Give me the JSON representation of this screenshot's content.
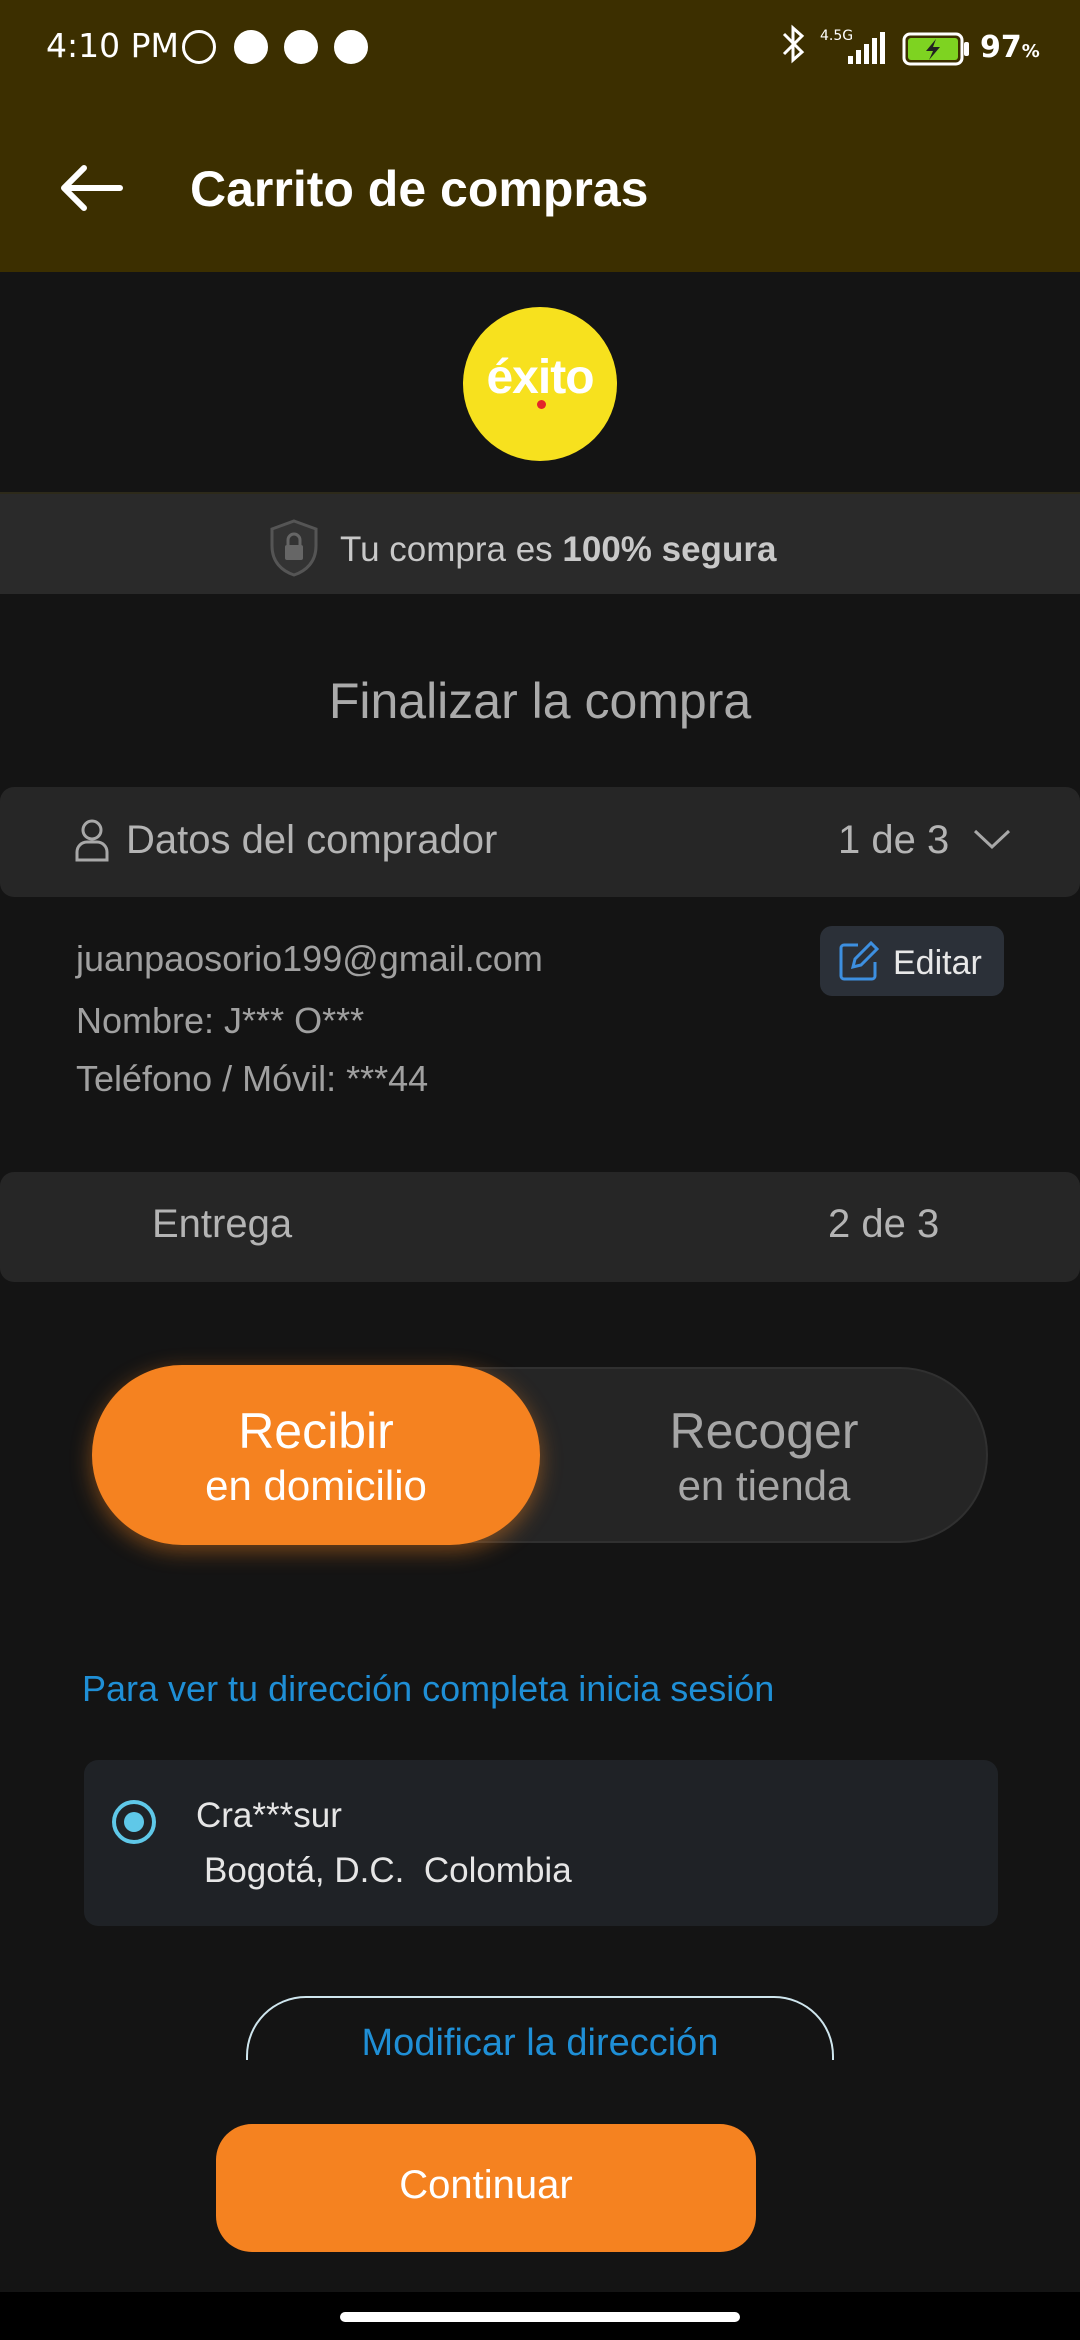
{
  "status_bar": {
    "time": "4:10 PM",
    "network": "4.5G",
    "battery": "97",
    "battery_unit": "%",
    "icons": [
      "alarm-icon",
      "app-icon",
      "app-icon",
      "app-icon",
      "bluetooth-icon",
      "signal-icon",
      "battery-charging-icon"
    ]
  },
  "header": {
    "title": "Carrito de compras",
    "back_icon": "arrow-left-icon"
  },
  "brand": {
    "logo_text": "éxito",
    "logo_color": "#f7e11e"
  },
  "security": {
    "prefix": "Tu compra es ",
    "bold": "100% segura"
  },
  "checkout": {
    "heading": "Finalizar la compra",
    "buyer_section": {
      "label": "Datos del comprador",
      "step": "1 de 3",
      "email": "juanpaosorio199@gmail.com",
      "name": "Nombre: J*** O***",
      "phone": "Teléfono / Móvil: ***44",
      "edit_label": "Editar"
    },
    "delivery_section": {
      "label": "Entrega",
      "step": "2 de 3"
    },
    "delivery_options": {
      "home": {
        "line1": "Recibir",
        "line2": "en domicilio",
        "selected": true
      },
      "store": {
        "line1": "Recoger",
        "line2": "en tienda",
        "selected": false
      }
    },
    "login_prompt": "Para ver tu dirección completa inicia sesión",
    "address": {
      "line1": "Cra***sur",
      "line2": "Bogotá, D.C.  Colombia",
      "selected": true
    },
    "modify_label": "Modificar la dirección",
    "continue_label": "Continuar"
  },
  "colors": {
    "accent": "#f58220",
    "header_bg": "#3c2f00",
    "link": "#1f8fd6"
  }
}
